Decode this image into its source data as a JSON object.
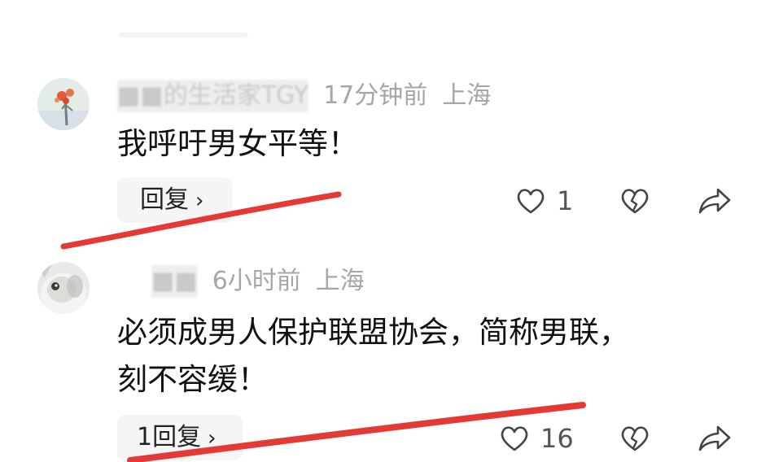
{
  "comments": [
    {
      "username": "■■的生活家TGY",
      "time": "17分钟前",
      "location": "上海",
      "text": "我呼吁男女平等！",
      "reply_label": "回复",
      "like_count": "1"
    },
    {
      "username": "■■",
      "time": "6小时前",
      "location": "上海",
      "text_line1": "必须成男人保护联盟协会，简称男联，",
      "text_line2": "刻不容缓！",
      "reply_label": "1回复",
      "like_count": "16"
    }
  ],
  "icons": {
    "like": "heart-icon",
    "dislike": "broken-heart-icon",
    "share": "share-arrow-icon",
    "chevron": "chevron-right-icon"
  },
  "colors": {
    "annotation": "#e53935",
    "meta_text": "#a6a6a6",
    "pill_bg": "#f5f5f5"
  }
}
